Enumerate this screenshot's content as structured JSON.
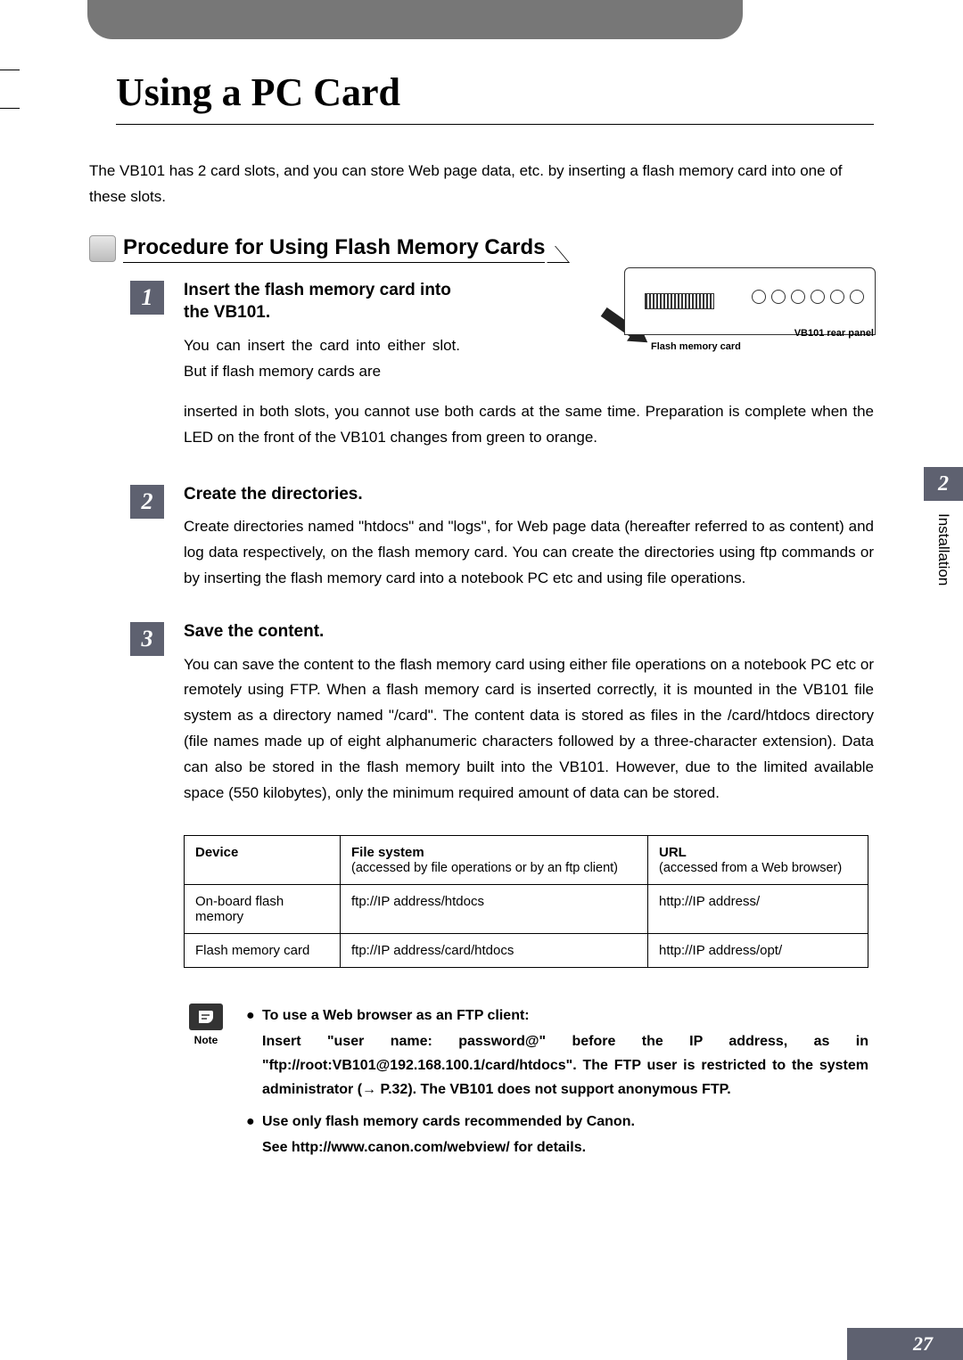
{
  "page_title": "Using a PC Card",
  "intro": "The VB101 has 2 card slots, and you can store Web page data, etc. by inserting a flash memory card into one of these slots.",
  "section_heading": "Procedure for Using Flash Memory Cards",
  "steps": [
    {
      "num": "1",
      "title": "Insert the flash memory card into the VB101.",
      "text_narrow": "You can insert the card into either slot. But if flash memory cards are",
      "text_cont": "inserted in both slots, you cannot use both cards at the same time. Preparation is complete when the LED on the front of the VB101 changes from green to orange."
    },
    {
      "num": "2",
      "title": "Create the directories.",
      "text": "Create directories named \"htdocs\" and \"logs\", for Web page data (hereafter referred to as content) and log data respectively, on the flash memory card. You can create the directories using ftp commands or by inserting the flash memory card into a notebook PC etc and using file operations."
    },
    {
      "num": "3",
      "title": "Save the content.",
      "text": "You can save the content to the flash memory card using either file operations on a notebook PC etc or remotely using FTP. When a flash memory card is inserted correctly, it is mounted in the VB101 file system as a directory named \"/card\". The content data is stored as files in the /card/htdocs directory (file names made up of eight alphanumeric characters followed by a three-character extension). Data can also be stored in the flash memory built into the VB101. However, due to the limited available space (550 kilobytes), only the minimum required amount of data can be stored."
    }
  ],
  "diagram": {
    "label_card": "Flash memory card",
    "label_panel": "VB101 rear panel"
  },
  "table": {
    "headers": {
      "device": "Device",
      "fs_main": "File system",
      "fs_sub": "(accessed by file operations or by an ftp client)",
      "url_main": "URL",
      "url_sub": "(accessed from a Web browser)"
    },
    "rows": [
      {
        "device": "On-board flash memory",
        "fs": "ftp://IP address/htdocs",
        "url": "http://IP address/"
      },
      {
        "device": "Flash memory card",
        "fs": "ftp://IP address/card/htdocs",
        "url": "http://IP address/opt/"
      }
    ]
  },
  "note": {
    "label": "Note",
    "bullets": [
      {
        "lead": "To use a Web browser as an FTP client:",
        "body": "Insert \"user name: password@\" before the IP address, as in \"ftp://root:VB101@192.168.100.1/card/htdocs\". The FTP user is restricted to the system administrator (→ P.32). The VB101 does not support anonymous FTP."
      },
      {
        "lead": "Use only flash memory cards recommended by Canon.",
        "body": "See http://www.canon.com/webview/ for details."
      }
    ]
  },
  "side_tab": "2",
  "side_text": "Installation",
  "page_number": "27"
}
